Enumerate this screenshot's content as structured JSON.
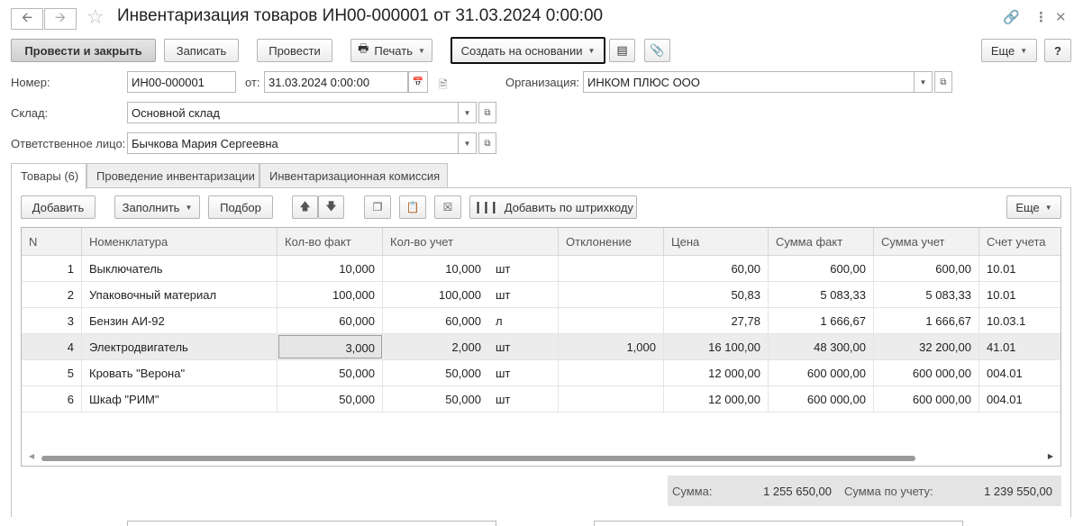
{
  "header": {
    "title": "Инвентаризация товаров ИН00-000001 от 31.03.2024 0:00:00"
  },
  "toolbar": {
    "post_close": "Провести и закрыть",
    "save": "Записать",
    "post": "Провести",
    "print": "Печать",
    "create_based": "Создать на основании",
    "more": "Еще",
    "help": "?"
  },
  "form": {
    "number_label": "Номер:",
    "number_value": "ИН00-000001",
    "date_label": "от:",
    "date_value": "31.03.2024  0:00:00",
    "org_label": "Организация:",
    "org_value": "ИНКОМ ПЛЮС ООО",
    "warehouse_label": "Склад:",
    "warehouse_value": "Основной склад",
    "responsible_label": "Ответственное лицо:",
    "responsible_value": "Бычкова Мария Сергеевна"
  },
  "tabs": [
    {
      "label": "Товары (6)"
    },
    {
      "label": "Проведение инвентаризации"
    },
    {
      "label": "Инвентаризационная комиссия"
    }
  ],
  "table_toolbar": {
    "add": "Добавить",
    "fill": "Заполнить",
    "pick": "Подбор",
    "add_barcode": "Добавить по штрихкоду",
    "more": "Еще"
  },
  "table": {
    "columns": [
      "N",
      "Номенклатура",
      "Кол-во факт",
      "Кол-во учет",
      "",
      "Отклонение",
      "Цена",
      "Сумма факт",
      "Сумма учет",
      "Счет учета"
    ],
    "rows": [
      {
        "n": "1",
        "name": "Выключатель",
        "fact": "10,000",
        "acc": "10,000",
        "unit": "шт",
        "dev": "",
        "price": "60,00",
        "sum_fact": "600,00",
        "sum_acc": "600,00",
        "account": "10.01"
      },
      {
        "n": "2",
        "name": "Упаковочный материал",
        "fact": "100,000",
        "acc": "100,000",
        "unit": "шт",
        "dev": "",
        "price": "50,83",
        "sum_fact": "5 083,33",
        "sum_acc": "5 083,33",
        "account": "10.01"
      },
      {
        "n": "3",
        "name": "Бензин АИ-92",
        "fact": "60,000",
        "acc": "60,000",
        "unit": "л",
        "dev": "",
        "price": "27,78",
        "sum_fact": "1 666,67",
        "sum_acc": "1 666,67",
        "account": "10.03.1"
      },
      {
        "n": "4",
        "name": "Электродвигатель",
        "fact": "3,000",
        "acc": "2,000",
        "unit": "шт",
        "dev": "1,000",
        "price": "16 100,00",
        "sum_fact": "48 300,00",
        "sum_acc": "32 200,00",
        "account": "41.01"
      },
      {
        "n": "5",
        "name": "Кровать \"Верона\"",
        "fact": "50,000",
        "acc": "50,000",
        "unit": "шт",
        "dev": "",
        "price": "12 000,00",
        "sum_fact": "600 000,00",
        "sum_acc": "600 000,00",
        "account": "004.01"
      },
      {
        "n": "6",
        "name": "Шкаф \"РИМ\"",
        "fact": "50,000",
        "acc": "50,000",
        "unit": "шт",
        "dev": "",
        "price": "12 000,00",
        "sum_fact": "600 000,00",
        "sum_acc": "600 000,00",
        "account": "004.01"
      }
    ]
  },
  "totals": {
    "sum_label": "Сумма:",
    "sum_value": "1 255 650,00",
    "acc_label": "Сумма по учету:",
    "acc_value": "1 239 550,00"
  }
}
